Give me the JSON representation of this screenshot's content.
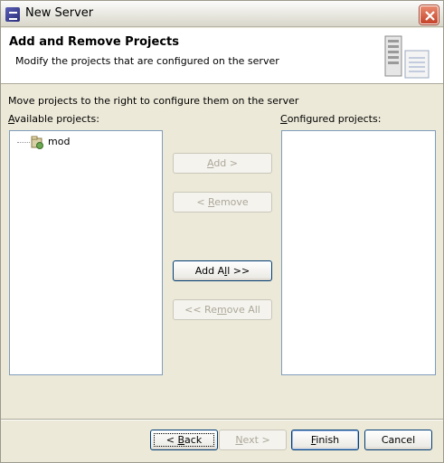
{
  "window": {
    "title": "New Server"
  },
  "banner": {
    "title": "Add and Remove Projects",
    "description": "Modify the projects that are configured on the server"
  },
  "instruction": "Move projects to the right to configure them on the server",
  "available": {
    "label_mnemonic": "A",
    "label_rest": "vailable projects:",
    "items": [
      {
        "label": "mod",
        "icon": "project-icon"
      }
    ]
  },
  "configured": {
    "label_mnemonic": "C",
    "label_rest": "onfigured projects:",
    "items": []
  },
  "buttons": {
    "add": {
      "pre": "",
      "mnemonic": "A",
      "post": "dd >",
      "enabled": false
    },
    "remove": {
      "pre": "< ",
      "mnemonic": "R",
      "post": "emove",
      "enabled": false
    },
    "add_all": {
      "pre": "Add A",
      "mnemonic": "l",
      "post": "l >>",
      "enabled": true
    },
    "remove_all": {
      "pre": "<< Re",
      "mnemonic": "m",
      "post": "ove All",
      "enabled": false
    }
  },
  "footer": {
    "back": {
      "pre": "< ",
      "mnemonic": "B",
      "post": "ack",
      "enabled": true
    },
    "next": {
      "pre": "",
      "mnemonic": "N",
      "post": "ext >",
      "enabled": false
    },
    "finish": {
      "pre": "",
      "mnemonic": "F",
      "post": "inish",
      "enabled": true
    },
    "cancel": {
      "label": "Cancel",
      "enabled": true
    }
  },
  "colors": {
    "title_close": "#c4432a",
    "list_border": "#7f9db9",
    "dialog_bg": "#ece9d8"
  }
}
